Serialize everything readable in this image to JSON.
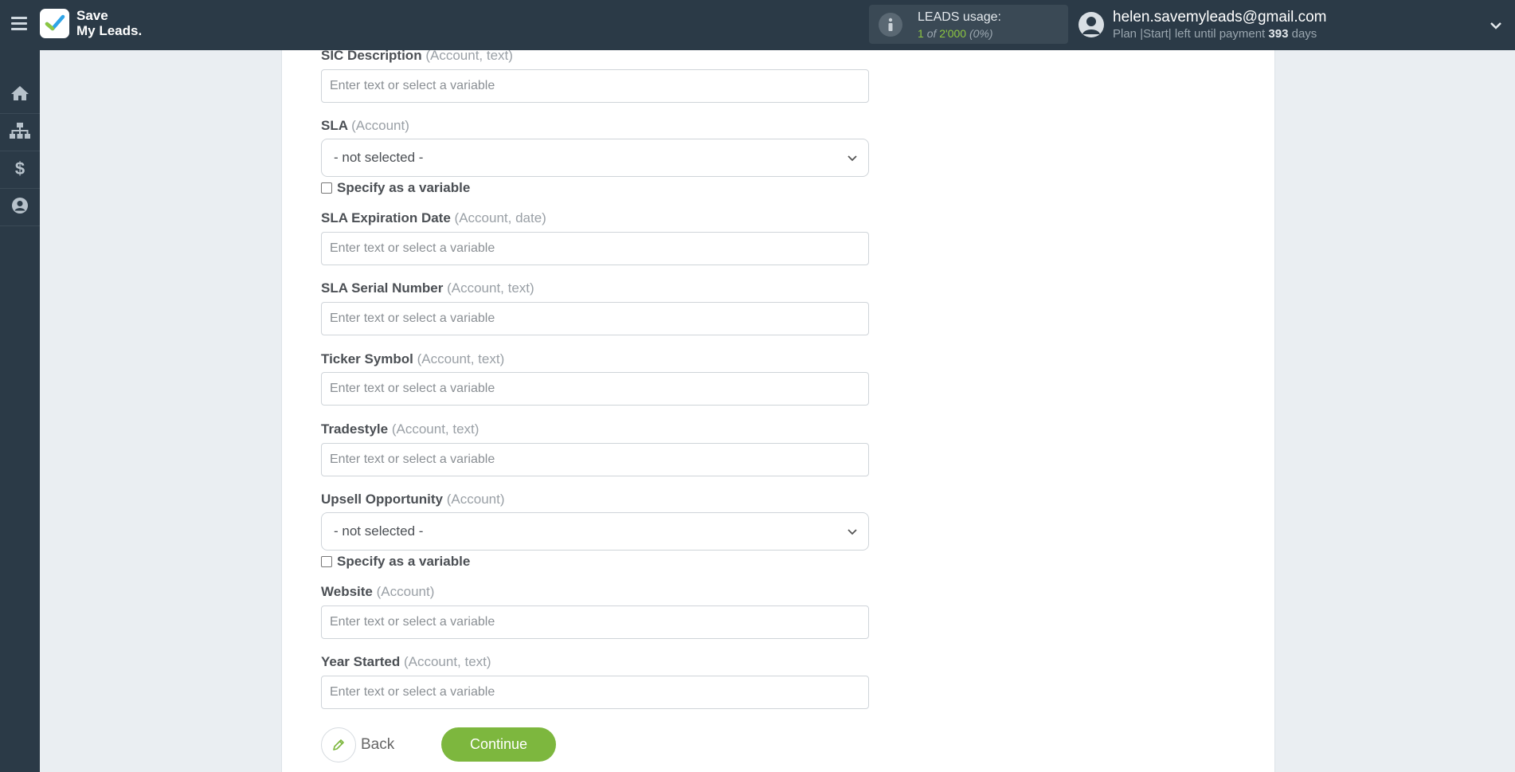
{
  "app": {
    "logo_line1": "Save",
    "logo_line2": "My Leads."
  },
  "usage": {
    "title": "LEADS usage:",
    "used": "1",
    "of_text": "of",
    "limit": "2'000",
    "percent": "(0%)"
  },
  "user": {
    "email": "helen.savemyleads@gmail.com",
    "plan_text": "Plan |Start| left until payment",
    "days_left": "393",
    "days_label": "days"
  },
  "sidebar": {
    "items": [
      {
        "icon": "home-icon"
      },
      {
        "icon": "sitemap-icon"
      },
      {
        "icon": "dollar-icon"
      },
      {
        "icon": "user-circle-icon"
      }
    ]
  },
  "form": {
    "placeholder": "Enter text or select a variable",
    "sic_description": {
      "label": "SIC Description",
      "hint": "(Account, text)"
    },
    "sla": {
      "label": "SLA",
      "hint": "(Account)",
      "value": "- not selected -",
      "checkbox": "Specify as a variable"
    },
    "sla_expiration": {
      "label": "SLA Expiration Date",
      "hint": "(Account, date)"
    },
    "sla_serial": {
      "label": "SLA Serial Number",
      "hint": "(Account, text)"
    },
    "ticker": {
      "label": "Ticker Symbol",
      "hint": "(Account, text)"
    },
    "tradestyle": {
      "label": "Tradestyle",
      "hint": "(Account, text)"
    },
    "upsell": {
      "label": "Upsell Opportunity",
      "hint": "(Account)",
      "value": "- not selected -",
      "checkbox": "Specify as a variable"
    },
    "website": {
      "label": "Website",
      "hint": "(Account)"
    },
    "year_started": {
      "label": "Year Started",
      "hint": "(Account, text)"
    }
  },
  "actions": {
    "back_label": "Back",
    "continue_label": "Continue"
  },
  "colors": {
    "topbar": "#2b3a47",
    "accent_green": "#7db73e",
    "usage_green": "#8dc641"
  }
}
